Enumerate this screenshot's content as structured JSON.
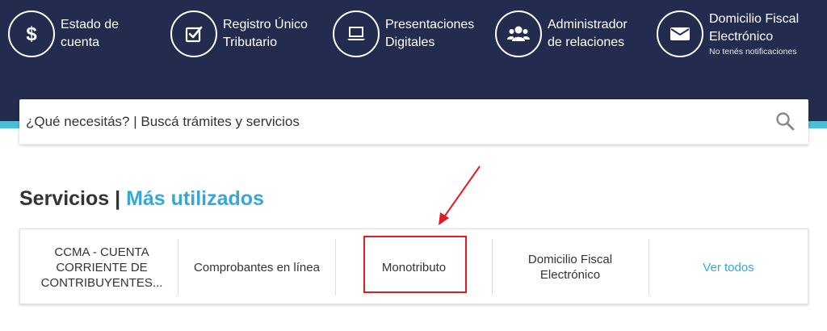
{
  "shortcuts": [
    {
      "lines": [
        "Estado de",
        "cuenta"
      ],
      "icon": "dollar-icon"
    },
    {
      "lines": [
        "Registro Único",
        "Tributario"
      ],
      "icon": "check-square-icon"
    },
    {
      "lines": [
        "Presentaciones",
        "Digitales"
      ],
      "icon": "laptop-icon"
    },
    {
      "lines": [
        "Administrador",
        "de relaciones"
      ],
      "icon": "users-icon"
    },
    {
      "lines": [
        "Domicilio Fiscal",
        "Electrónico"
      ],
      "sub": "No tenés notificaciones",
      "icon": "envelope-icon"
    }
  ],
  "search": {
    "placeholder": "¿Qué necesitás? | Buscá trámites y servicios"
  },
  "section": {
    "title": "Servicios |",
    "accent": "Más utilizados"
  },
  "services": {
    "ccma": [
      "CCMA - CUENTA",
      "CORRIENTE DE",
      "CONTRIBUYENTES..."
    ],
    "comprobantes": "Comprobantes en línea",
    "monotributo": "Monotributo",
    "domicilio": [
      "Domicilio Fiscal",
      "Electrónico"
    ],
    "ver_todos": "Ver todos"
  },
  "colors": {
    "header": "#232c4f",
    "accent": "#37a7d8",
    "strip": "#4bbfd6",
    "highlight": "#e31b23"
  }
}
